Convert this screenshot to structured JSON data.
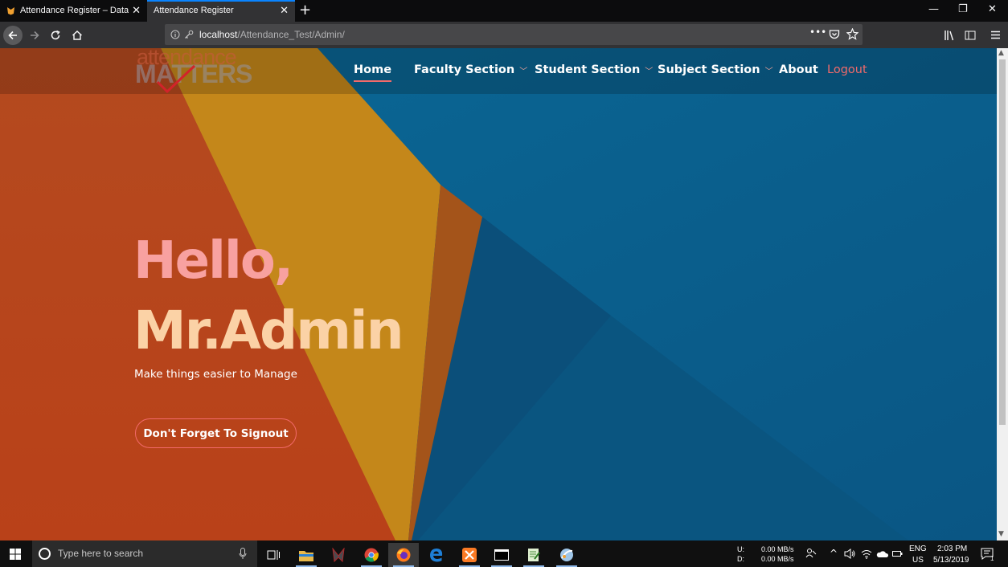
{
  "browser": {
    "tabs": [
      {
        "title": "Attendance Register – Databa",
        "active": false
      },
      {
        "title": "Attendance Register",
        "active": true
      }
    ],
    "new_tab_symbol": "+",
    "url": {
      "host": "localhost",
      "path": "/Attendance_Test/Admin/"
    },
    "page_actions": "•••"
  },
  "site": {
    "logo": {
      "line1": "attendance",
      "line2": "MATTERS"
    },
    "nav": {
      "home": "Home",
      "faculty": "Faculty Section",
      "student": "Student Section",
      "subject": "Subject Section",
      "about": "About",
      "logout": "Logout"
    },
    "hero": {
      "greeting": "Hello,",
      "name": "Mr.Admin",
      "tagline": "Make things easier to Manage",
      "cta": "Don't Forget To Signout"
    },
    "colors": {
      "accent": "#f26a6a",
      "greeting": "#f8a1a0",
      "name": "#fbd2a6",
      "bg_blue": "#0b5d8c",
      "bg_orange": "#b5491c",
      "bg_gold": "#c98a14"
    }
  },
  "taskbar": {
    "search_placeholder": "Type here to search",
    "net": {
      "up_label": "U:",
      "down_label": "D:",
      "up_value": "0.00 MB/s",
      "down_value": "0.00 MB/s"
    },
    "lang": "ENG",
    "region": "US",
    "time": "2:03 PM",
    "date": "5/13/2019",
    "notifications": "1"
  }
}
